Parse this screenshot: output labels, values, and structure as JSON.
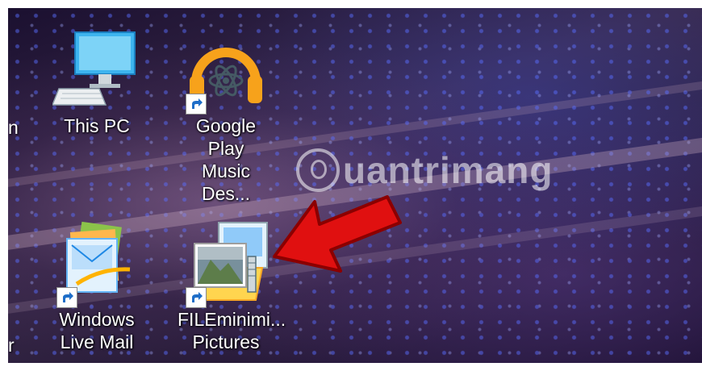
{
  "desktop": {
    "left_partial_label_top": "n",
    "left_partial_label_bottom": "r",
    "icons": [
      {
        "name": "This PC",
        "line1": "This PC",
        "line2": "",
        "icon": "computer-icon",
        "shortcut": false
      },
      {
        "name": "Google Play Music Des...",
        "line1": "Google Play",
        "line2": "Music Des...",
        "icon": "google-play-music-icon",
        "shortcut": true
      },
      {
        "name": "Windows Live Mail",
        "line1": "Windows",
        "line2": "Live Mail",
        "icon": "windows-live-mail-icon",
        "shortcut": true
      },
      {
        "name": "FILEminimi... Pictures",
        "line1": "FILEminimi...",
        "line2": "Pictures",
        "icon": "fileminimizer-pictures-icon",
        "shortcut": true
      }
    ]
  },
  "watermark": {
    "text": "uantrimang"
  },
  "colors": {
    "arrow": "#e01010",
    "headphone": "#f7a21b",
    "monitor": "#3db4ef"
  }
}
